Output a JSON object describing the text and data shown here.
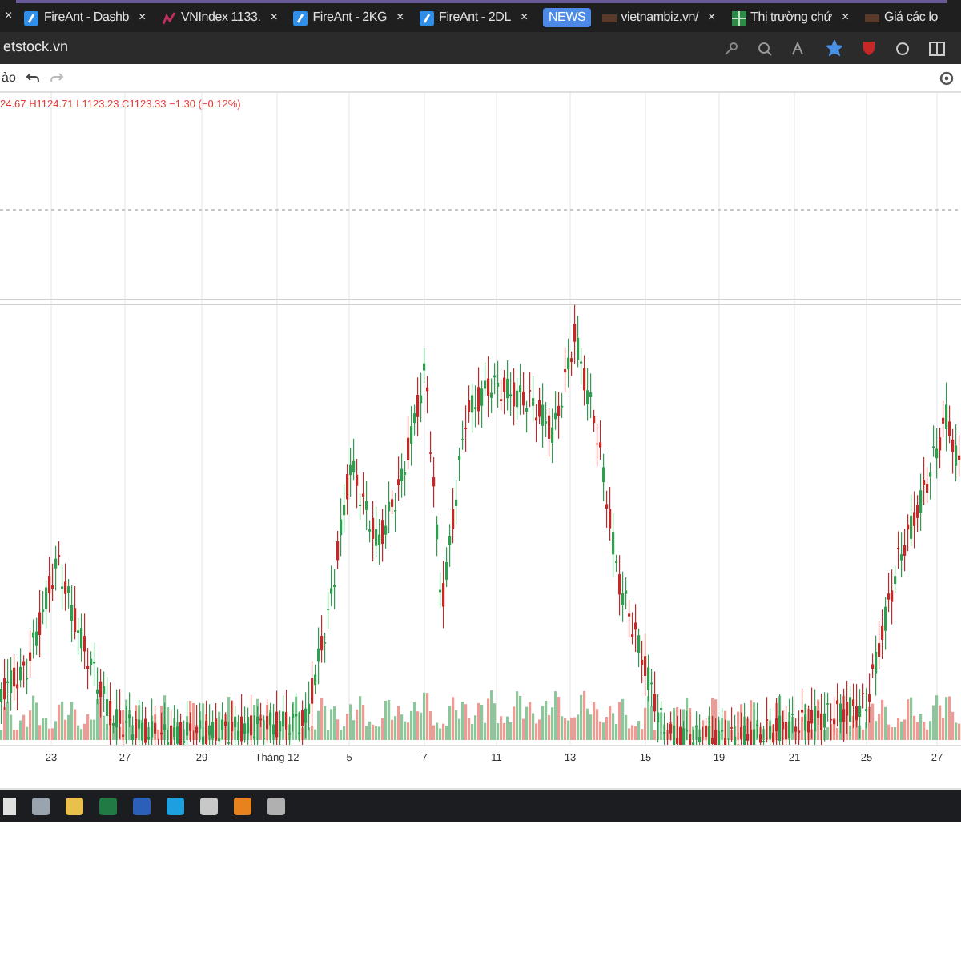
{
  "browser": {
    "tabs": [
      {
        "title": "FireAnt - Dashb",
        "selected": false
      },
      {
        "title": "VNIndex 1133.",
        "selected": false
      },
      {
        "title": "FireAnt - 2KG",
        "selected": false
      },
      {
        "title": "FireAnt - 2DL",
        "selected": false
      },
      {
        "title": "vietnambiz.vn/",
        "selected": false,
        "badge": "NEWS"
      },
      {
        "title": "Thị trường chứ",
        "selected": false
      },
      {
        "title": "Giá các lo",
        "selected": false
      }
    ],
    "close_glyph": "×",
    "address": "etstock.vn",
    "favorite": true
  },
  "toolbar": {
    "label": "ảo"
  },
  "legend": "24.67 H1124.71 L1123.23 C1123.33 −1.30 (−0.12%)",
  "x_labels": [
    "23",
    "27",
    "29",
    "Tháng 12",
    "5",
    "7",
    "11",
    "13",
    "15",
    "19",
    "21",
    "25",
    "27"
  ]
}
